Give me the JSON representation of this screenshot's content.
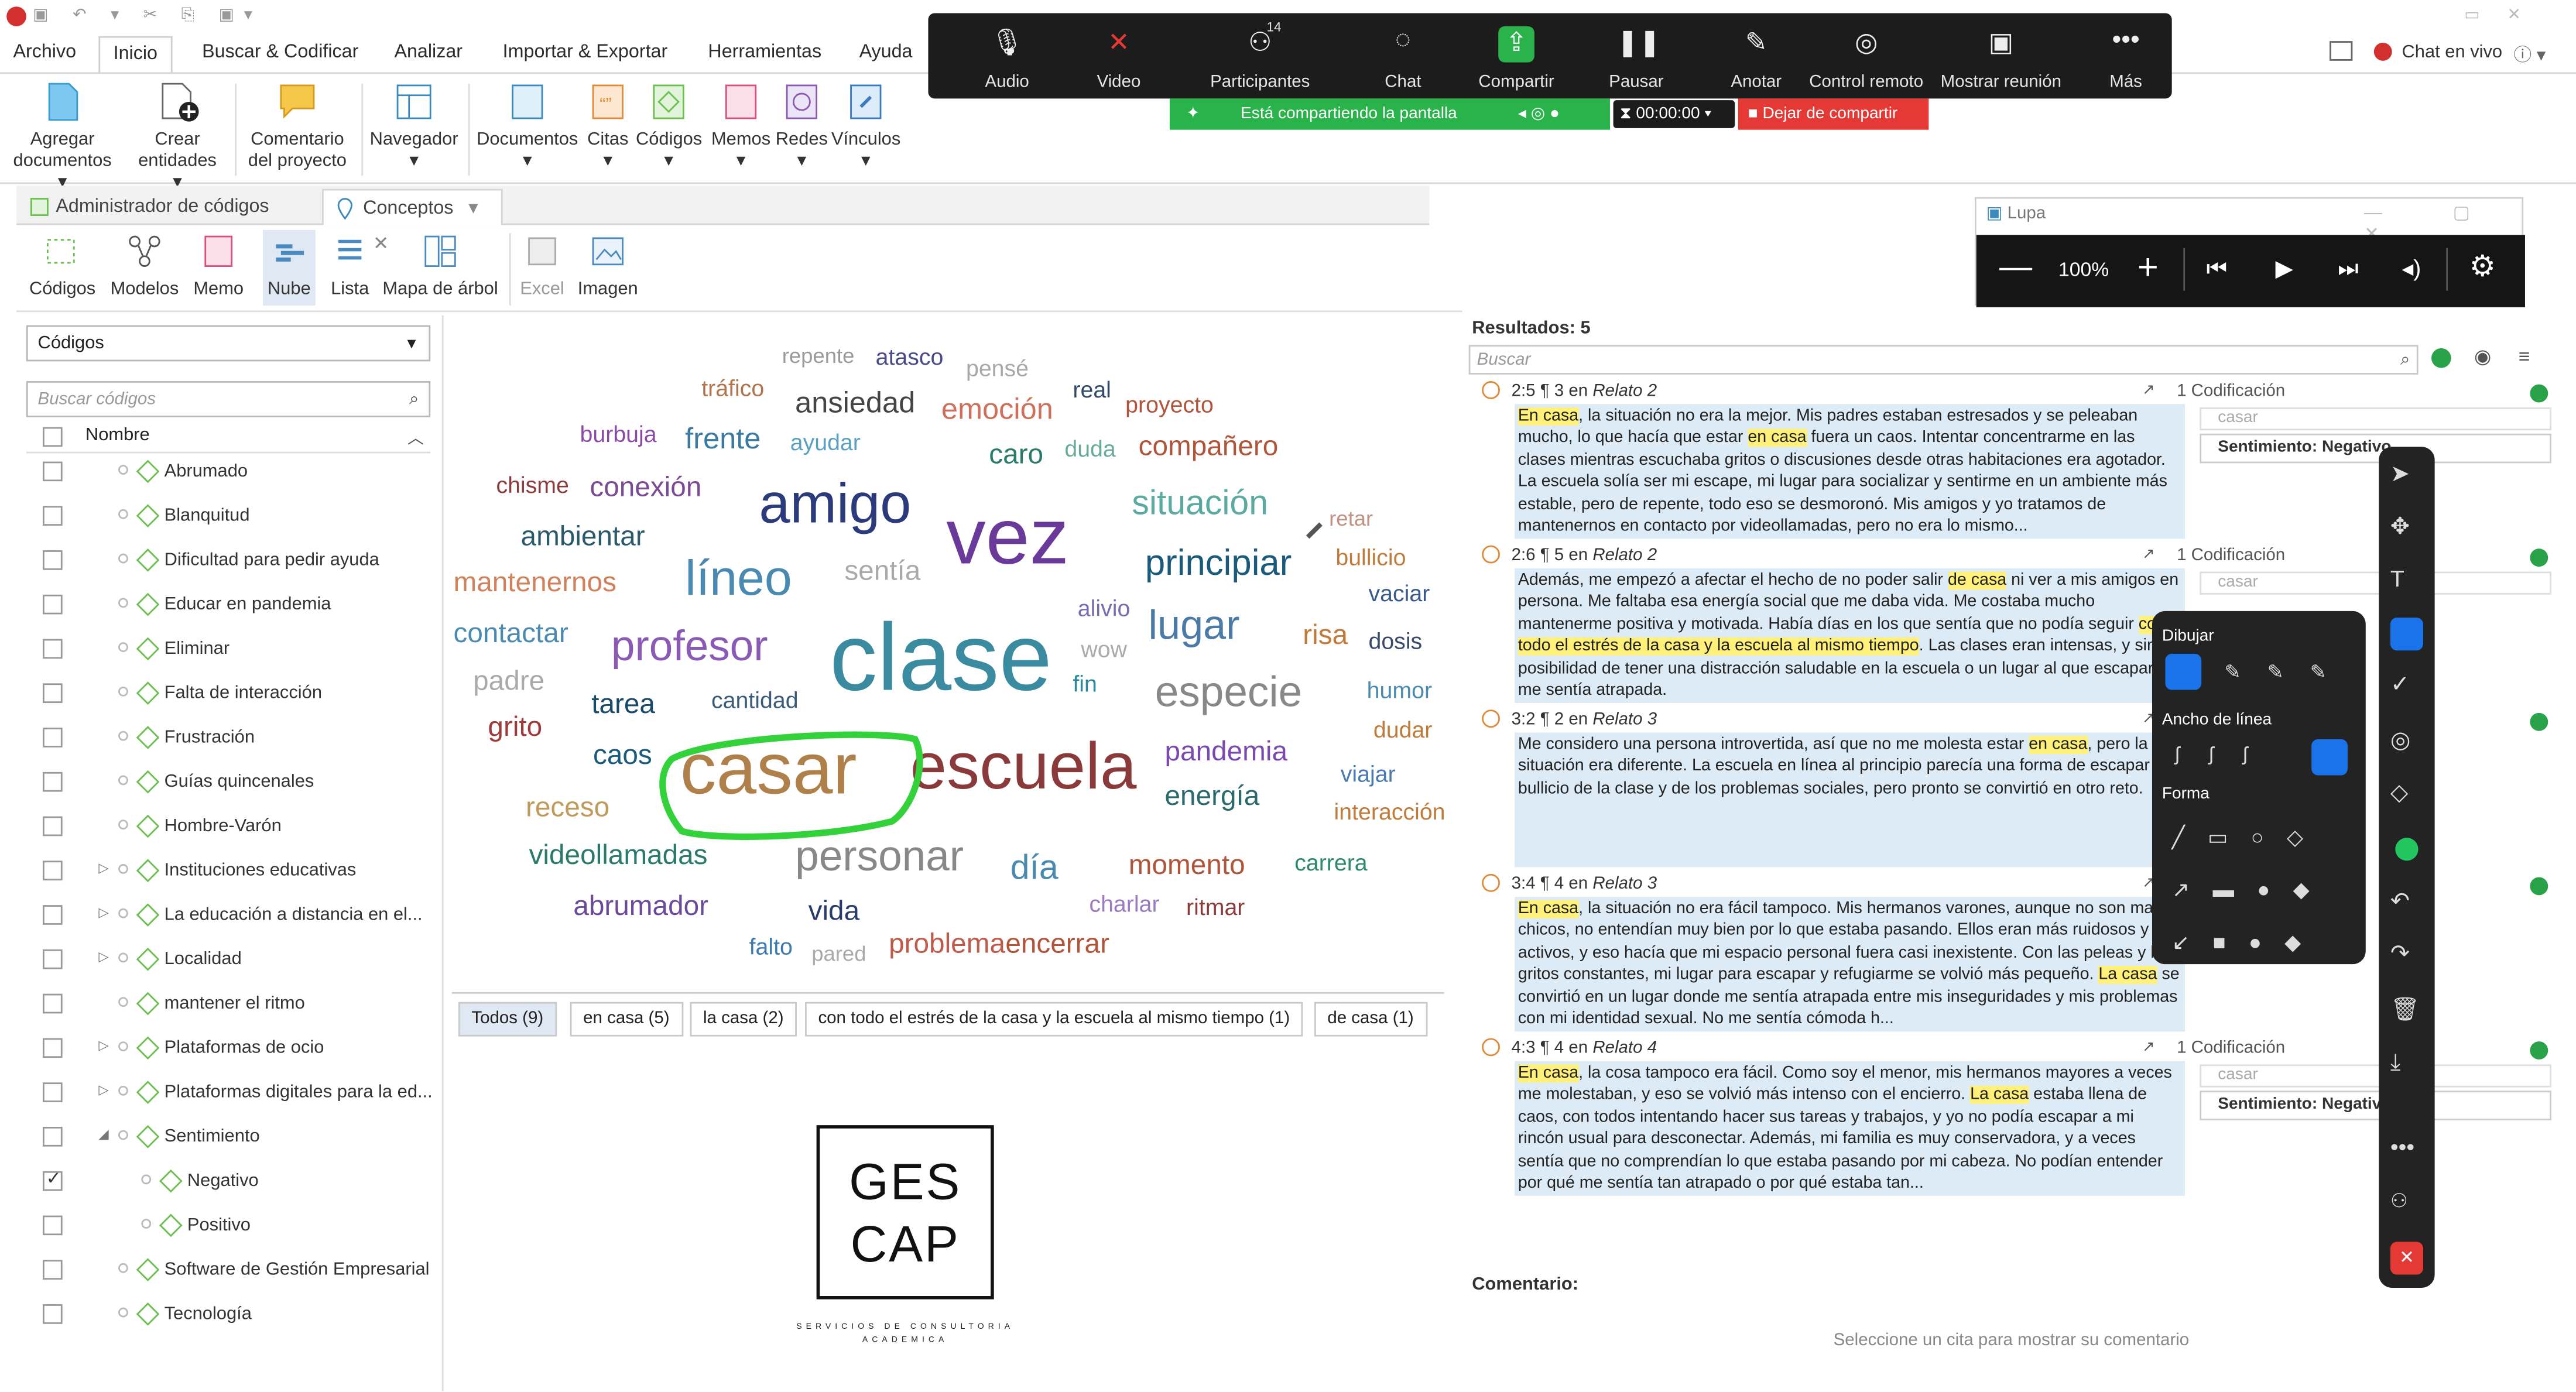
{
  "menu": {
    "tabs": [
      "Archivo",
      "Inicio",
      "Buscar & Codificar",
      "Analizar",
      "Importar & Exportar",
      "Herramientas",
      "Ayuda"
    ],
    "active": "Inicio",
    "live_chat": "Chat en vivo"
  },
  "ribbon": {
    "agregar": "Agregar documentos",
    "crear": "Crear entidades",
    "comentario": "Comentario del proyecto",
    "navegador": "Navegador",
    "documentos": "Documentos",
    "citas": "Citas",
    "codigos": "Códigos",
    "memos": "Memos",
    "redes": "Redes",
    "vinculos": "Vínculos"
  },
  "doc_tabs": {
    "admin": "Administrador de códigos",
    "conceptos": "Conceptos"
  },
  "concept_toolbar": [
    "Códigos",
    "Modelos",
    "Memo",
    "Nube",
    "Lista",
    "Mapa de árbol",
    "Excel",
    "Imagen"
  ],
  "left_panel": {
    "dropdown": "Códigos",
    "search_placeholder": "Buscar códigos",
    "column": "Nombre",
    "codes": [
      {
        "label": "Abrumado",
        "expandable": false,
        "indent": 0,
        "checked": false
      },
      {
        "label": "Blanquitud",
        "expandable": false,
        "indent": 0,
        "checked": false
      },
      {
        "label": "Dificultad para pedir ayuda",
        "expandable": false,
        "indent": 0,
        "checked": false
      },
      {
        "label": "Educar en pandemia",
        "expandable": false,
        "indent": 0,
        "checked": false
      },
      {
        "label": "Eliminar",
        "expandable": false,
        "indent": 0,
        "checked": false
      },
      {
        "label": "Falta de interacción",
        "expandable": false,
        "indent": 0,
        "checked": false
      },
      {
        "label": "Frustración",
        "expandable": false,
        "indent": 0,
        "checked": false
      },
      {
        "label": "Guías quincenales",
        "expandable": false,
        "indent": 0,
        "checked": false
      },
      {
        "label": "Hombre-Varón",
        "expandable": false,
        "indent": 0,
        "checked": false
      },
      {
        "label": "Instituciones educativas",
        "expandable": true,
        "indent": 0,
        "checked": false
      },
      {
        "label": "La educación a distancia en el...",
        "expandable": true,
        "indent": 0,
        "checked": false
      },
      {
        "label": "Localidad",
        "expandable": true,
        "indent": 0,
        "checked": false
      },
      {
        "label": "mantener el ritmo",
        "expandable": false,
        "indent": 0,
        "checked": false
      },
      {
        "label": "Plataformas de ocio",
        "expandable": true,
        "indent": 0,
        "checked": false
      },
      {
        "label": "Plataformas digitales para la ed...",
        "expandable": true,
        "indent": 0,
        "checked": false
      },
      {
        "label": "Sentimiento",
        "expandable": true,
        "indent": 0,
        "checked": false,
        "open": true
      },
      {
        "label": "Negativo",
        "expandable": false,
        "indent": 1,
        "checked": true
      },
      {
        "label": "Positivo",
        "expandable": false,
        "indent": 1,
        "checked": false
      },
      {
        "label": "Software de Gestión Empresarial",
        "expandable": false,
        "indent": 0,
        "checked": false
      },
      {
        "label": "Tecnología",
        "expandable": false,
        "indent": 0,
        "checked": false
      }
    ]
  },
  "cloud": {
    "words": [
      {
        "t": "repente",
        "c": "#9a9a9a"
      },
      {
        "t": "atasco",
        "c": "#4a4a8a"
      },
      {
        "t": "pensé",
        "c": "#a8a8a8"
      },
      {
        "t": "tráfico",
        "c": "#b0734a"
      },
      {
        "t": "ansiedad",
        "c": "#444"
      },
      {
        "t": "emoción",
        "c": "#d0705a"
      },
      {
        "t": "real",
        "c": "#334a6a"
      },
      {
        "t": "proyecto",
        "c": "#b0543a"
      },
      {
        "t": "burbuja",
        "c": "#8a4aa5"
      },
      {
        "t": "frente",
        "c": "#3a7aa0"
      },
      {
        "t": "ayudar",
        "c": "#5aa0c0"
      },
      {
        "t": "caro",
        "c": "#2a7a6a"
      },
      {
        "t": "duda",
        "c": "#6aaa9a"
      },
      {
        "t": "compañero",
        "c": "#b0543a"
      },
      {
        "t": "chisme",
        "c": "#8a3a3a"
      },
      {
        "t": "conexión",
        "c": "#7a4a95"
      },
      {
        "t": "amigo",
        "c": "#2a3a7a"
      },
      {
        "t": "vez",
        "c": "#6a3a9a"
      },
      {
        "t": "situación",
        "c": "#5aaaa0"
      },
      {
        "t": "retar",
        "c": "#c09080"
      },
      {
        "t": "ambientar",
        "c": "#2a5a6a"
      },
      {
        "t": "principiar",
        "c": "#1a5a7a"
      },
      {
        "t": "bullicio",
        "c": "#c07a3a"
      },
      {
        "t": "mantenernos",
        "c": "#d0805a"
      },
      {
        "t": "líneo",
        "c": "#4a8ab0"
      },
      {
        "t": "sentía",
        "c": "#aaa"
      },
      {
        "t": "vaciar",
        "c": "#3a5a8a"
      },
      {
        "t": "contactar",
        "c": "#4a8ab0"
      },
      {
        "t": "profesor",
        "c": "#8a5ab5"
      },
      {
        "t": "clase",
        "c": "#3a8aa0"
      },
      {
        "t": "alivio",
        "c": "#7a6ab0"
      },
      {
        "t": "lugar",
        "c": "#4a7aa5"
      },
      {
        "t": "risa",
        "c": "#c07a3a"
      },
      {
        "t": "wow",
        "c": "#aaa"
      },
      {
        "t": "dosis",
        "c": "#3a4a6a"
      },
      {
        "t": "padre",
        "c": "#aaa"
      },
      {
        "t": "tarea",
        "c": "#1a4a6a"
      },
      {
        "t": "fin",
        "c": "#2a8a9a"
      },
      {
        "t": "especie",
        "c": "#888"
      },
      {
        "t": "humor",
        "c": "#4a8ab0"
      },
      {
        "t": "cantidad",
        "c": "#3a5a7a"
      },
      {
        "t": "grito",
        "c": "#a03a3a"
      },
      {
        "t": "dudar",
        "c": "#c07a3a"
      },
      {
        "t": "caos",
        "c": "#1a5a7a"
      },
      {
        "t": "casar",
        "c": "#b0804a"
      },
      {
        "t": "escuela",
        "c": "#8a3a3a"
      },
      {
        "t": "pandemia",
        "c": "#7a4ab0"
      },
      {
        "t": "viajar",
        "c": "#4a7ab0"
      },
      {
        "t": "energía",
        "c": "#2a6a6a"
      },
      {
        "t": "interacción",
        "c": "#c07a3a"
      },
      {
        "t": "receso",
        "c": "#c09a5a"
      },
      {
        "t": "videollamadas",
        "c": "#2a7a6a"
      },
      {
        "t": "personar",
        "c": "#888"
      },
      {
        "t": "día",
        "c": "#4a8ab0"
      },
      {
        "t": "momento",
        "c": "#b0543a"
      },
      {
        "t": "carrera",
        "c": "#2a8a6a"
      },
      {
        "t": "abrumador",
        "c": "#6a4a9a"
      },
      {
        "t": "vida",
        "c": "#2a3a6a"
      },
      {
        "t": "charlar",
        "c": "#9a7ac0"
      },
      {
        "t": "ritmar",
        "c": "#8a3a3a"
      },
      {
        "t": "falto",
        "c": "#3a7ab0"
      },
      {
        "t": "pared",
        "c": "#aaa"
      },
      {
        "t": "problema",
        "c": "#c05a4a"
      },
      {
        "t": "encerrar",
        "c": "#b0543a"
      }
    ],
    "chips": [
      "Todos (9)",
      "en casa (5)",
      "la casa (2)",
      "con todo el estrés de la casa y la escuela al mismo tiempo (1)",
      "de casa (1)"
    ],
    "logo_line1": "GES",
    "logo_line2": "CAP",
    "logo_tagline": "SERVICIOS DE CONSULTORIA ACADEMICA"
  },
  "results": {
    "count": "Resultados: 5",
    "search_placeholder": "Buscar",
    "items": [
      {
        "id": "2:5",
        "par": "¶ 3",
        "doc": "Relato 2",
        "cod": "1 Codificación",
        "code1": "casar",
        "code2": "Sentimiento: Negativo",
        "html": "<span class='hl'>En casa</span>, la situación no era la mejor. Mis padres estaban estresados y se peleaban mucho, lo que hacía que estar <span class='hl'>en casa</span> fuera un caos. Intentar concentrarme en las clases mientras escuchaba gritos o discusiones desde otras habitaciones era agotador. La escuela solía ser mi escape, mi lugar para socializar y sentirme en un ambiente más estable, pero de repente, todo eso se desmoronó. Mis amigos y yo tratamos de mantenernos en contacto por videollamadas, pero no era lo mismo..."
      },
      {
        "id": "2:6",
        "par": "¶ 5",
        "doc": "Relato 2",
        "cod": "1 Codificación",
        "code1": "casar",
        "code2": "",
        "html": "Además, me empezó a afectar el hecho de no poder salir <span class='hl'>de casa</span> ni ver a mis amigos en persona. Me faltaba esa energía social que me daba vida. Me costaba mucho mantenerme positiva y motivada. Había días en los que sentía que no podía seguir <span class='hl'>con todo el estrés de la casa y la escuela al mismo tiempo</span>. Las clases eran intensas, y sin la posibilidad de tener una distracción saludable en la escuela o un lugar al que escapar, me sentía atrapada."
      },
      {
        "id": "3:2",
        "par": "¶ 2",
        "doc": "Relato 3",
        "cod": "",
        "code1": "",
        "code2": "",
        "html": "Me considero una persona introvertida, así que no me molesta estar <span class='hl'>en casa</span>, pero la situación era diferente. La escuela en línea al principio parecía una forma de escapar del bullicio de la clase y de los problemas sociales, pero pronto se convirtió en otro reto."
      },
      {
        "id": "3:4",
        "par": "¶ 4",
        "doc": "Relato 3",
        "cod": "",
        "code1": "",
        "code2": "",
        "html": "<span class='hl'>En casa</span>, la situación no era fácil tampoco. Mis hermanos varones, aunque no son malos chicos, no entendían muy bien por lo que estaba pasando. Ellos eran más ruidosos y activos, y eso hacía que mi espacio personal fuera casi inexistente. Con las peleas y los gritos constantes, mi lugar para escapar y refugiarme se volvió más pequeño. <span class='hl'>La casa</span> se convirtió en un lugar donde me sentía atrapada entre mis inseguridades y mis problemas con mi identidad sexual. No me sentía cómoda h..."
      },
      {
        "id": "4:3",
        "par": "¶ 4",
        "doc": "Relato 4",
        "cod": "1 Codificación",
        "code1": "casar",
        "code2": "Sentimiento: Negativo",
        "html": "<span class='hl'>En casa</span>, la cosa tampoco era fácil. Como soy el menor, mis hermanos mayores a veces me molestaban, y eso se volvió más intenso con el encierro. <span class='hl'>La casa</span> estaba llena de caos, con todos intentando hacer sus tareas y trabajos, y yo no podía escapar a mi rincón usual para desconectar. Además, mi familia es muy conservadora, y a veces sentía que no comprendían lo que estaba pasando por mi cabeza. No podían entender por qué me sentía tan atrapado o por qué estaba tan..."
      }
    ],
    "comment_label": "Comentario:",
    "comment_hint": "Seleccione un cita para mostrar su comentario"
  },
  "zoom": {
    "buttons": [
      "Audio",
      "Video",
      "Participantes",
      "Chat",
      "Compartir",
      "Pausar",
      "Anotar",
      "Control remoto",
      "Mostrar reunión",
      "Más"
    ],
    "participants": "14",
    "sharing": "Está compartiendo la pantalla",
    "timer": "00:00:00",
    "stop": "Dejar de compartir"
  },
  "lupa": {
    "title": "Lupa",
    "zoom": "100%"
  },
  "draw": {
    "title": "Dibujar",
    "width": "Ancho de línea",
    "shape": "Forma"
  },
  "colors": {
    "accent": "#1a73e8",
    "brand_red": "#d32f2f",
    "green": "#22c55e",
    "highlight": "#fff07a",
    "quote_bg": "#dcebf6"
  }
}
